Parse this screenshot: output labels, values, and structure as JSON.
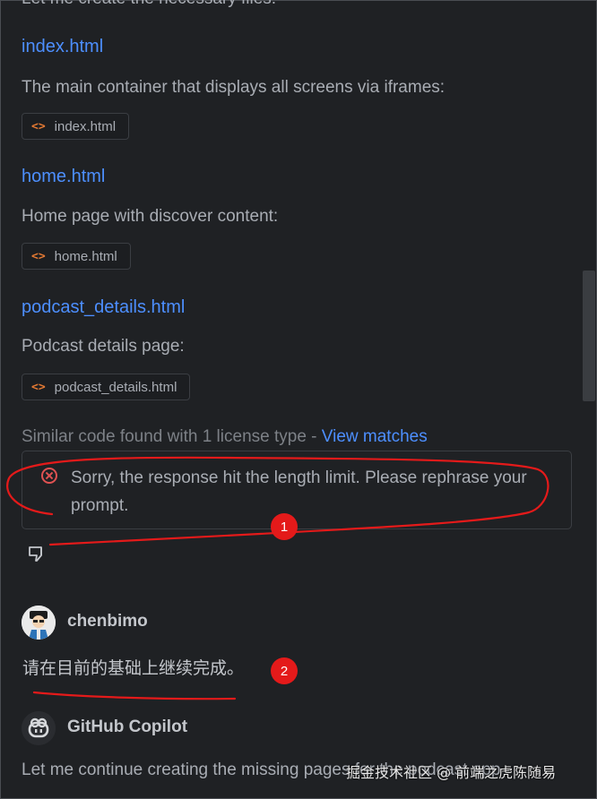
{
  "top_partial_text": "Let me create the necessary files:",
  "files": [
    {
      "name": "index.html",
      "description": "The main container that displays all screens via iframes:",
      "chip": "index.html"
    },
    {
      "name": "home.html",
      "description": "Home page with discover content:",
      "chip": "home.html"
    },
    {
      "name": "podcast_details.html",
      "description": "Podcast details page:",
      "chip": "podcast_details.html"
    }
  ],
  "similar_code": {
    "text": "Similar code found with 1 license type - ",
    "link": "View matches"
  },
  "error": {
    "message": "Sorry, the response hit the length limit. Please rephrase your prompt."
  },
  "user_message": {
    "username": "chenbimo",
    "text": "请在目前的基础上继续完成。"
  },
  "copilot": {
    "name": "GitHub Copilot",
    "text": "Let me continue creating the missing pages for the podcast app"
  },
  "watermark": "掘金技术社区 @ 前端之虎陈随易",
  "annotations": [
    "1",
    "2"
  ],
  "colors": {
    "background": "#1f2124",
    "link": "#4d8fff",
    "error": "#e05252",
    "annotation": "#e41a1a"
  },
  "icons": [
    "code-icon",
    "error-icon",
    "thumbs-down-icon",
    "avatar",
    "copilot-icon"
  ]
}
